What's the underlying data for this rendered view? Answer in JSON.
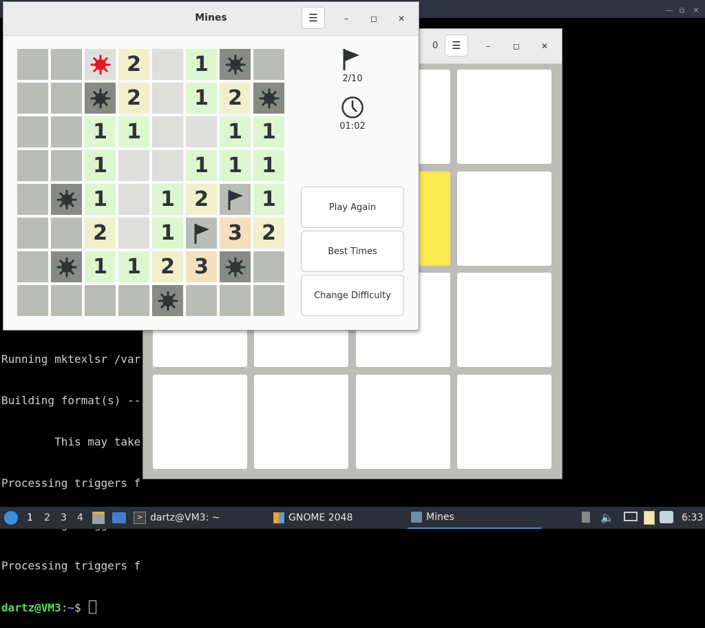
{
  "terminal": {
    "lines": [
      "Running mktexlsr /var",
      "Building format(s) --",
      "        This may take",
      "Processing triggers f",
      "Processing triggers f",
      "Processing triggers f"
    ],
    "prompt_user": "dartz@VM3",
    "prompt_sep": ":",
    "prompt_path": "~",
    "prompt_symbol": "$"
  },
  "game2048": {
    "score": "0",
    "menu_icon": "hamburger-menu-icon",
    "yellow_color": "#fce94f"
  },
  "mines": {
    "title": "Mines",
    "menu_icon": "hamburger-menu-icon",
    "flags_counter": "2/10",
    "timer": "01:02",
    "buttons": {
      "play_again": "Play Again",
      "best_times": "Best Times",
      "change_difficulty": "Change Difficulty"
    },
    "board": [
      [
        "H",
        "H",
        "X",
        "2",
        "E",
        "1",
        "M",
        "H"
      ],
      [
        "H",
        "H",
        "M",
        "2",
        "E",
        "1",
        "2",
        "M"
      ],
      [
        "H",
        "H",
        "1",
        "1",
        "E",
        "E",
        "1",
        "1"
      ],
      [
        "H",
        "H",
        "1",
        "E",
        "E",
        "1",
        "1",
        "1"
      ],
      [
        "H",
        "M",
        "1",
        "E",
        "1",
        "2",
        "F",
        "1"
      ],
      [
        "H",
        "H",
        "2",
        "E",
        "1",
        "F",
        "3",
        "2"
      ],
      [
        "H",
        "M",
        "1",
        "1",
        "2",
        "3",
        "M",
        "H"
      ],
      [
        "H",
        "H",
        "H",
        "H",
        "M",
        "H",
        "H",
        "H"
      ]
    ]
  },
  "taskbar": {
    "workspaces": [
      "1",
      "2",
      "3",
      "4"
    ],
    "windows": [
      {
        "label": "dartz@VM3: ~",
        "icon": "terminal-icon"
      },
      {
        "label": "GNOME 2048",
        "icon": "2048-icon"
      },
      {
        "label": "Mines",
        "icon": "mines-icon"
      }
    ],
    "clock": "6:33"
  }
}
